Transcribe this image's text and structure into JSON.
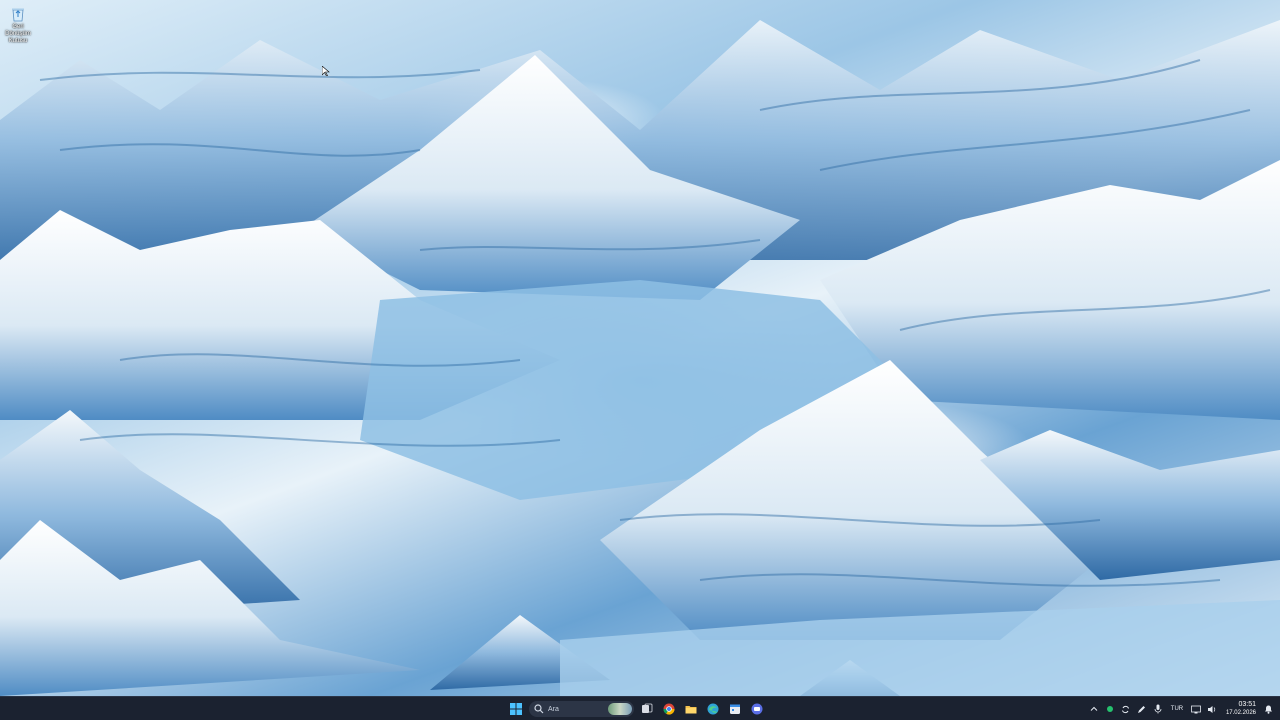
{
  "desktop": {
    "icons": [
      {
        "label": "Geri Dönüşüm Kutusu",
        "icon": "recycle-bin-icon"
      }
    ]
  },
  "taskbar": {
    "start_icon": "windows-start-icon",
    "search": {
      "placeholder": "Ara"
    },
    "pinned": [
      {
        "name": "task-view",
        "icon": "task-view-icon",
        "color": "#d9dde5"
      },
      {
        "name": "chrome",
        "icon": "chrome-icon",
        "color": "#db4437"
      },
      {
        "name": "file-explorer",
        "icon": "folder-icon",
        "color": "#f2c14e"
      },
      {
        "name": "edge",
        "icon": "edge-icon",
        "color": "#2fa4d6"
      },
      {
        "name": "calendar",
        "icon": "calendar-app-icon",
        "color": "#e8ecf2"
      },
      {
        "name": "chat",
        "icon": "chat-app-icon",
        "color": "#5b6fe6"
      }
    ],
    "tray": {
      "language": "TUR",
      "time": "03:51",
      "date": "17.02.2026"
    }
  },
  "colors": {
    "taskbar_bg": "#1b2230",
    "accent": "#3a8ee6"
  }
}
